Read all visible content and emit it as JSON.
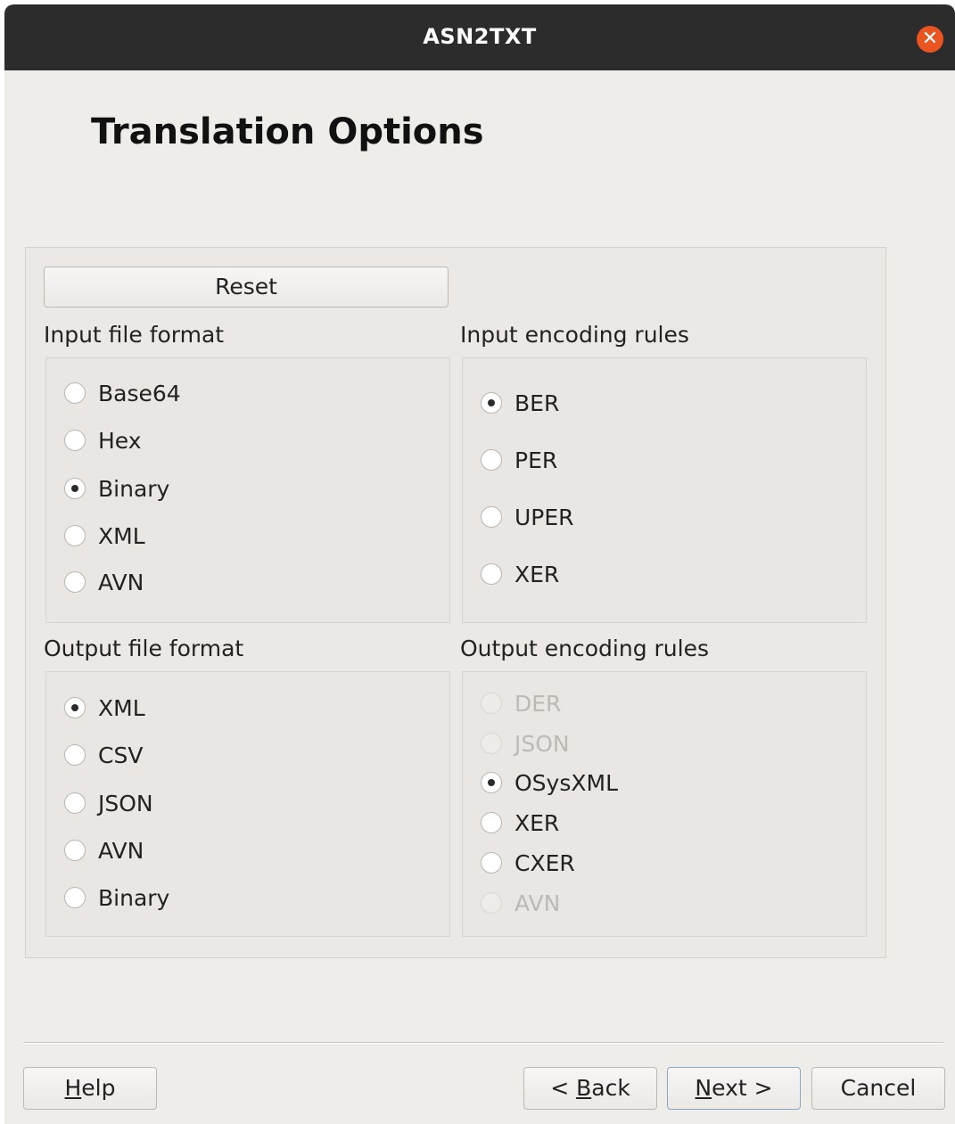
{
  "window": {
    "title": "ASN2TXT",
    "close_glyph": "✕",
    "close_icon": "close-icon",
    "close_color": "#e95420"
  },
  "page": {
    "title": "Translation Options"
  },
  "reset_label": "Reset",
  "input_file_format": {
    "label": "Input file format",
    "options": [
      {
        "label": "Base64",
        "checked": false
      },
      {
        "label": "Hex",
        "checked": false
      },
      {
        "label": "Binary",
        "checked": true
      },
      {
        "label": "XML",
        "checked": false
      },
      {
        "label": "AVN",
        "checked": false
      }
    ]
  },
  "input_encoding_rules": {
    "label": "Input encoding rules",
    "options": [
      {
        "label": "BER",
        "checked": true
      },
      {
        "label": "PER",
        "checked": false
      },
      {
        "label": "UPER",
        "checked": false
      },
      {
        "label": "XER",
        "checked": false
      }
    ]
  },
  "output_file_format": {
    "label": "Output file format",
    "options": [
      {
        "label": "XML",
        "checked": true
      },
      {
        "label": "CSV",
        "checked": false
      },
      {
        "label": "JSON",
        "checked": false
      },
      {
        "label": "AVN",
        "checked": false
      },
      {
        "label": "Binary",
        "checked": false
      }
    ]
  },
  "output_encoding_rules": {
    "label": "Output encoding rules",
    "options": [
      {
        "label": "DER",
        "checked": false,
        "disabled": true
      },
      {
        "label": "JSON",
        "checked": false,
        "disabled": true
      },
      {
        "label": "OSysXML",
        "checked": true,
        "disabled": false
      },
      {
        "label": "XER",
        "checked": false,
        "disabled": false
      },
      {
        "label": "CXER",
        "checked": false,
        "disabled": false
      },
      {
        "label": "AVN",
        "checked": false,
        "disabled": true
      }
    ]
  },
  "footer": {
    "help": {
      "mnemonic": "H",
      "rest": "elp"
    },
    "back": {
      "prefix": "< ",
      "mnemonic": "B",
      "rest": "ack"
    },
    "next": {
      "mnemonic": "N",
      "rest": "ext >"
    },
    "cancel": "Cancel"
  }
}
